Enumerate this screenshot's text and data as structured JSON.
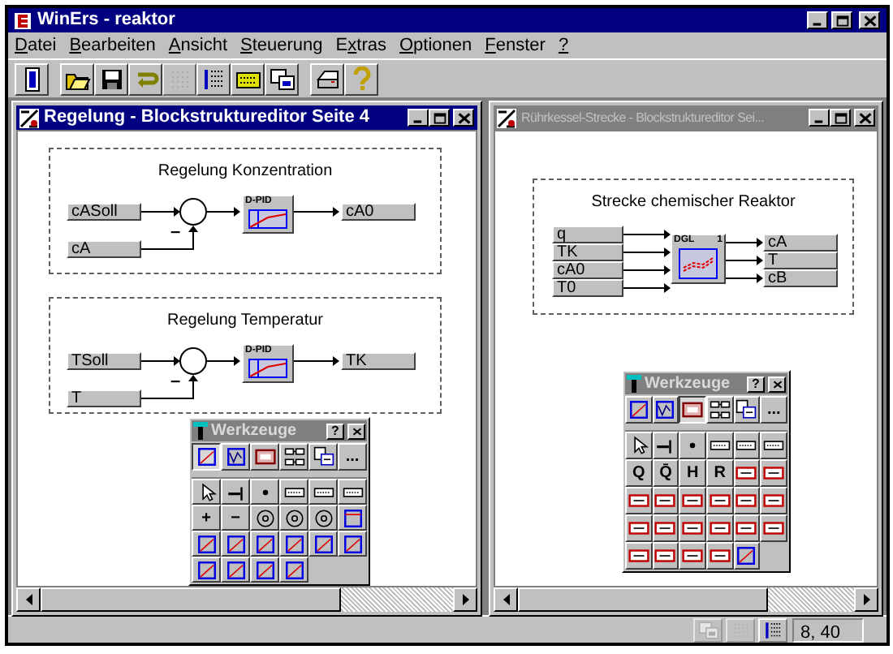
{
  "app": {
    "title": "WinErs - reaktor"
  },
  "menu": [
    {
      "key": "D",
      "after": "atei"
    },
    {
      "key": "B",
      "after": "earbeiten"
    },
    {
      "key": "A",
      "after": "nsicht"
    },
    {
      "key": "S",
      "after": "teuerung"
    },
    {
      "before": "E",
      "key": "x",
      "after": "tras"
    },
    {
      "key": "O",
      "after": "ptionen"
    },
    {
      "key": "F",
      "after": "enster"
    },
    {
      "key": "?"
    }
  ],
  "toolbar_groups": [
    [
      {
        "kind": "page",
        "disabled": false
      }
    ],
    [
      {
        "kind": "open",
        "disabled": false
      },
      {
        "kind": "save",
        "disabled": false
      },
      {
        "kind": "undo",
        "disabled": false
      },
      {
        "kind": "grid",
        "disabled": true
      },
      {
        "kind": "list",
        "disabled": false
      },
      {
        "kind": "keyboard",
        "disabled": false
      },
      {
        "kind": "windows",
        "disabled": false
      }
    ],
    [
      {
        "kind": "print",
        "disabled": false
      },
      {
        "kind": "help",
        "disabled": false
      }
    ]
  ],
  "windows": [
    {
      "title": "Regelung - Blockstruktureditor Seite 4",
      "active": true,
      "groups": [
        {
          "kind": "controller",
          "title": "Regelung Konzentration",
          "setpoint": "cASoll",
          "feedback": "cA",
          "sign": "–",
          "block": "D-PID",
          "output": "cA0"
        },
        {
          "kind": "controller",
          "title": "Regelung Temperatur",
          "setpoint": "TSoll",
          "feedback": "T",
          "sign": "–",
          "block": "D-PID",
          "output": "TK"
        }
      ],
      "toolbox": {
        "title": "Werkzeuge",
        "help": "?",
        "tabs": [
          {
            "kind": "chart",
            "selected": true
          },
          {
            "kind": "wave",
            "selected": false
          },
          {
            "kind": "display",
            "selected": false
          },
          {
            "kind": "list",
            "selected": false
          },
          {
            "kind": "windows",
            "selected": false
          },
          {
            "label": "...",
            "selected": false
          }
        ],
        "tools": [
          {
            "kind": "pointer"
          },
          {
            "kind": "wire"
          },
          {
            "kind": "node"
          },
          {
            "kind": "io"
          },
          {
            "kind": "io"
          },
          {
            "kind": "io"
          },
          {
            "kind": "text",
            "label": "+"
          },
          {
            "kind": "text",
            "label": "−"
          },
          {
            "kind": "round"
          },
          {
            "kind": "round"
          },
          {
            "kind": "round"
          },
          {
            "kind": "frame"
          },
          {
            "kind": "chart"
          },
          {
            "kind": "chart"
          },
          {
            "kind": "chart"
          },
          {
            "kind": "chart"
          },
          {
            "kind": "chart"
          },
          {
            "kind": "chart"
          },
          {
            "kind": "chart"
          },
          {
            "kind": "chart"
          },
          {
            "kind": "chart"
          },
          {
            "kind": "chart"
          }
        ]
      }
    },
    {
      "title": "Rührkessel-Strecke - Blockstruktureditor Sei...",
      "active": false,
      "groups": [
        {
          "kind": "plant",
          "title": "Strecke chemischer Reaktor",
          "inputs": [
            "q",
            "TK",
            "cA0",
            "T0"
          ],
          "block": "DGL",
          "block_index": "1",
          "outputs": [
            "cA",
            "T",
            "cB"
          ]
        }
      ],
      "toolbox": {
        "title": "Werkzeuge",
        "help": "?",
        "tabs": [
          {
            "kind": "chart",
            "selected": false
          },
          {
            "kind": "wave",
            "selected": false
          },
          {
            "kind": "display",
            "selected": true
          },
          {
            "kind": "list",
            "selected": false
          },
          {
            "kind": "windows",
            "selected": false
          },
          {
            "label": "...",
            "selected": false
          }
        ],
        "tools": [
          {
            "kind": "pointer"
          },
          {
            "kind": "wire"
          },
          {
            "kind": "node"
          },
          {
            "kind": "io"
          },
          {
            "kind": "io"
          },
          {
            "kind": "io"
          },
          {
            "kind": "text",
            "label": "Q"
          },
          {
            "kind": "text",
            "label": "Q̄"
          },
          {
            "kind": "text",
            "label": "H"
          },
          {
            "kind": "text",
            "label": "R"
          },
          {
            "kind": "block"
          },
          {
            "kind": "block"
          },
          {
            "kind": "block"
          },
          {
            "kind": "block"
          },
          {
            "kind": "block"
          },
          {
            "kind": "block"
          },
          {
            "kind": "block"
          },
          {
            "kind": "block"
          },
          {
            "kind": "block"
          },
          {
            "kind": "block"
          },
          {
            "kind": "block"
          },
          {
            "kind": "block"
          },
          {
            "kind": "block"
          },
          {
            "kind": "block"
          },
          {
            "kind": "block"
          },
          {
            "kind": "block"
          },
          {
            "kind": "block"
          },
          {
            "kind": "block"
          },
          {
            "kind": "chart"
          }
        ]
      }
    }
  ],
  "status_bar": {
    "icons": [
      {
        "kind": "windows",
        "disabled": true
      },
      {
        "kind": "grid",
        "disabled": true
      },
      {
        "kind": "list",
        "disabled": false
      }
    ],
    "position": "8, 40"
  }
}
